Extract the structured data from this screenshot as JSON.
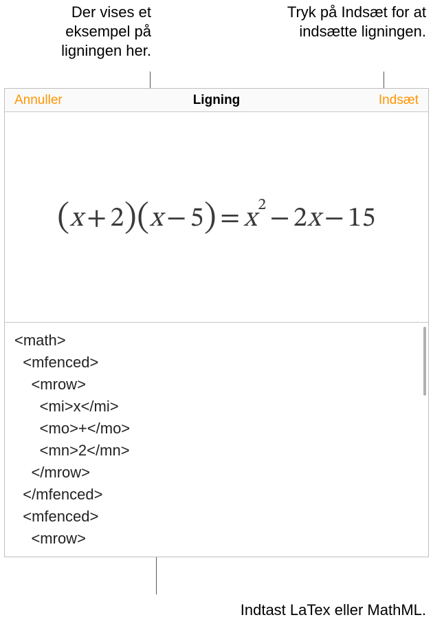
{
  "callouts": {
    "preview": "Der vises et eksempel på ligningen her.",
    "insert": "Tryk på Indsæt for at indsætte ligningen.",
    "input": "Indtast LaTex eller MathML."
  },
  "toolbar": {
    "cancel_label": "Annuller",
    "title": "Ligning",
    "insert_label": "Indsæt"
  },
  "preview": {
    "pieces": {
      "lp1": "(",
      "x1": "x",
      "plus": "+",
      "n2": "2",
      "rp1": ")",
      "lp2": "(",
      "x2": "x",
      "minus": "−",
      "n5": "5",
      "rp2": ")",
      "eq": "=",
      "x3": "x",
      "sq": "2",
      "minus2": "−",
      "n2b": "2",
      "x4": "x",
      "minus3": "−",
      "n15": "15"
    }
  },
  "editor": {
    "code": "<math>\n  <mfenced>\n    <mrow>\n      <mi>x</mi>\n      <mo>+</mo>\n      <mn>2</mn>\n    </mrow>\n  </mfenced>\n  <mfenced>\n    <mrow>"
  }
}
